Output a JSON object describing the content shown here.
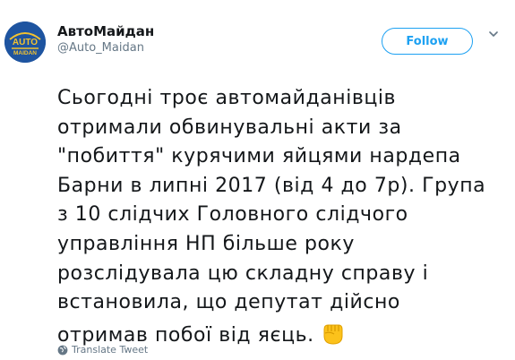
{
  "account": {
    "display_name": "АвтоМайдан",
    "handle": "@Auto_Maidan",
    "avatar_text_top": "AUTO",
    "avatar_text_bottom": "MAIDAN"
  },
  "actions": {
    "follow_label": "Follow"
  },
  "tweet": {
    "lines": [
      "Сьогодні троє автомайданівців",
      "отримали обвинувальні акти за",
      "\"побиття\" курячими яйцями нардепа",
      "Барни в липні 2017 (від 4 до 7р). Група",
      "з 10 слідчих Головного слідчого",
      "управління НП більше року",
      "розслідувала цю складну справу і",
      "встановила, що депутат дійсно",
      "отримав побої від яєць."
    ],
    "emoji": "raised-fist-emoji"
  },
  "footer": {
    "translate_label": "Translate Tweet"
  },
  "colors": {
    "accent": "#1da1f2",
    "secondary_text": "#657786",
    "avatar_bg": "#1e54a0",
    "avatar_accent": "#f2c230"
  }
}
